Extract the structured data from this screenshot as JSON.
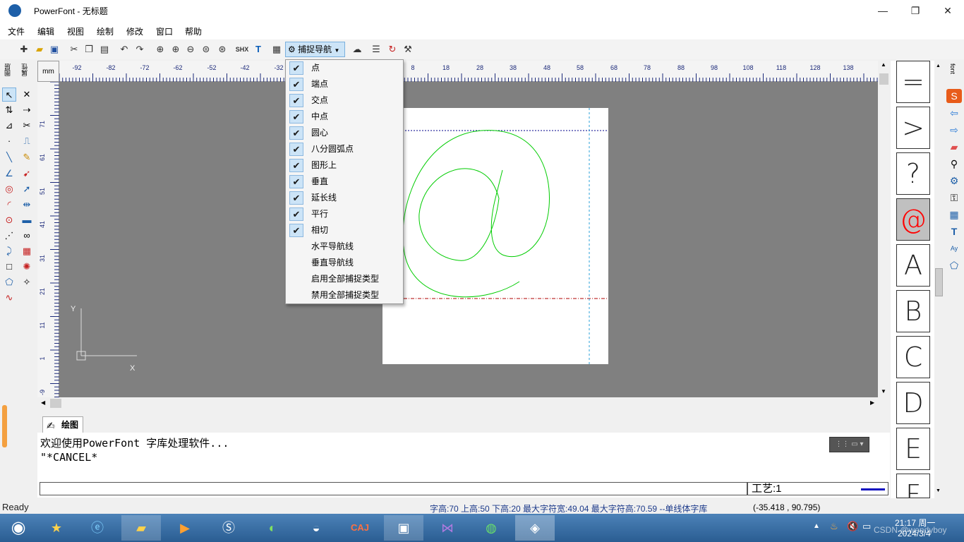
{
  "window": {
    "title": "PowerFont - 无标题",
    "minimize": "—",
    "restore": "❐",
    "close": "✕"
  },
  "menu": [
    "文件",
    "编辑",
    "视图",
    "绘制",
    "修改",
    "窗口",
    "帮助"
  ],
  "toolbar": {
    "shx_label": "SHX",
    "snap_button": "捕捉导航"
  },
  "left_tabs": [
    "图层",
    "属性"
  ],
  "ruler": {
    "unit": "mm",
    "h_ticks": [
      "-92",
      "-82",
      "-72",
      "-62",
      "-52",
      "-42",
      "-32",
      "8",
      "18",
      "28",
      "38",
      "48",
      "58",
      "68",
      "78",
      "88",
      "98",
      "108",
      "118",
      "128",
      "138"
    ],
    "v_ticks": [
      "71",
      "61",
      "51",
      "41",
      "31",
      "21",
      "11",
      "1",
      "-9"
    ]
  },
  "axis": {
    "x": "X",
    "y": "Y"
  },
  "snap_menu": [
    {
      "label": "点",
      "checked": true
    },
    {
      "label": "端点",
      "checked": true
    },
    {
      "label": "交点",
      "checked": true
    },
    {
      "label": "中点",
      "checked": true
    },
    {
      "label": "圆心",
      "checked": true
    },
    {
      "label": "八分圆弧点",
      "checked": true
    },
    {
      "label": "图形上",
      "checked": true
    },
    {
      "label": "垂直",
      "checked": true
    },
    {
      "label": "延长线",
      "checked": true
    },
    {
      "label": "平行",
      "checked": true
    },
    {
      "label": "相切",
      "checked": true
    },
    {
      "label": "水平导航线",
      "checked": false
    },
    {
      "label": "垂直导航线",
      "checked": false
    },
    {
      "label": "启用全部捕捉类型",
      "checked": false
    },
    {
      "label": "禁用全部捕捉类型",
      "checked": false
    }
  ],
  "check_mark": "✔",
  "glyph_panel": [
    "=",
    ">",
    "?",
    "@",
    "A",
    "B",
    "C",
    "D",
    "E",
    "F"
  ],
  "right_strip_label": "font",
  "command": {
    "tab_label": "绘图",
    "lines": [
      "欢迎使用PowerFont 字库处理软件...",
      "\"*CANCEL*"
    ],
    "input_value": "",
    "craft_label": "工艺:1"
  },
  "status": {
    "ready": "Ready",
    "metrics": "字高:70 上高:50 下高:20 最大字符宽:49.04  最大字符高:70.59  --单线体字库",
    "coords": "(-35.418 , 90.795)"
  },
  "taskbar": {
    "time": "21:17 周一",
    "date": "2024/3/4",
    "watermark": "CSDN @wendyboy",
    "apps": [
      "start",
      "star",
      "ie",
      "explorer",
      "media",
      "sogou",
      "browser",
      "qq",
      "caj",
      "remote",
      "vs",
      "wechat",
      "powerfont"
    ]
  },
  "colors": {
    "accent": "#cce4f7",
    "glyph_selected": "#ff0000",
    "drawing_green": "#00cc00"
  }
}
